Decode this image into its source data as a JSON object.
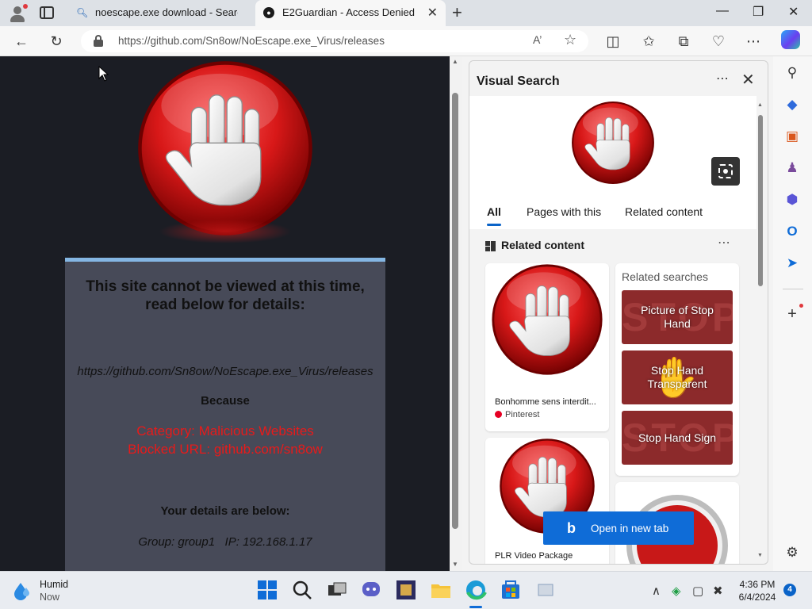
{
  "browser": {
    "tabs": [
      {
        "title": "noescape.exe download - Search",
        "favicon": "search-icon"
      },
      {
        "title": "E2Guardian - Access Denied",
        "favicon": "github-icon",
        "active": true
      }
    ],
    "address": "https://github.com/Sn8ow/NoEscape.exe_Virus/releases",
    "colors": {
      "accent": "#0f6cd7",
      "tab_strip": "#dde1e6"
    }
  },
  "page": {
    "heading": "This site cannot be viewed at this time, read below for details:",
    "blocked_url": "https://github.com/Sn8ow/NoEscape.exe_Virus/releases",
    "because": "Because",
    "category": "Category: Malicious Websites",
    "blocked_short": "Blocked URL: github.com/sn8ow",
    "details_heading": "Your details are below:",
    "group_line": "Group: group1   IP: 192.168.1.17",
    "colors": {
      "background": "#1b1d24",
      "panel": "#474a58",
      "panel_border": "#84b6e3",
      "alert_text": "#e81a1a"
    }
  },
  "visual_search": {
    "title": "Visual Search",
    "tabs": [
      "All",
      "Pages with this",
      "Related content"
    ],
    "active_tab": "All",
    "related_content_heading": "Related content",
    "cards": [
      {
        "title": "Bonhomme sens interdit...",
        "source": "Pinterest"
      },
      {
        "title": "PLR Video Package",
        "source": ""
      }
    ],
    "related_searches": {
      "title": "Related searches",
      "items": [
        "Picture of Stop Hand",
        "Stop Hand Transparent",
        "Stop Hand Sign"
      ]
    },
    "open_button": "Open in new tab"
  },
  "taskbar": {
    "weather": {
      "condition": "Humid",
      "time": "Now"
    },
    "clock": {
      "time": "4:36 PM",
      "date": "6/4/2024"
    },
    "notifications": "4"
  }
}
